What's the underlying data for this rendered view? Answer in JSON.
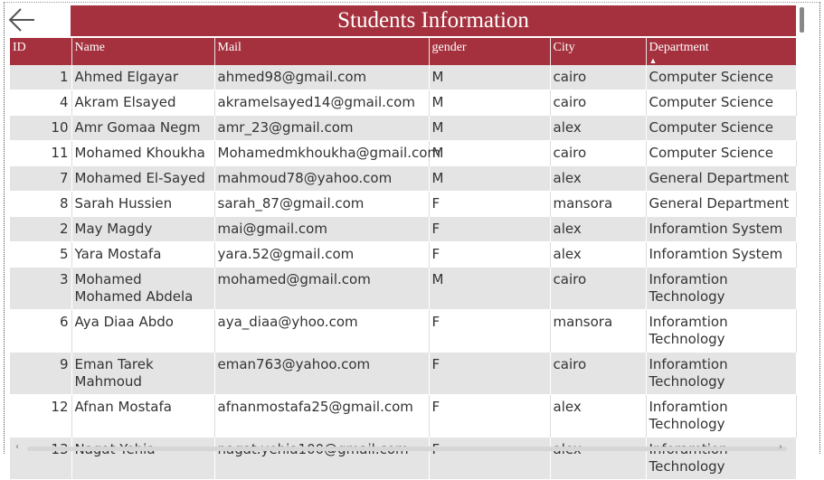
{
  "title": "Students Information",
  "icons": {
    "back": "arrow-left-icon"
  },
  "columns": [
    "ID",
    "Name",
    "Mail",
    "gender",
    "City",
    "Department"
  ],
  "sorted_column": "Department",
  "sort_indicator": "▲",
  "rows": [
    {
      "id": "1",
      "name": "Ahmed Elgayar",
      "mail": "ahmed98@gmail.com",
      "gender": "M",
      "city": "cairo",
      "department": "Computer Science"
    },
    {
      "id": "4",
      "name": "Akram Elsayed",
      "mail": "akramelsayed14@gmail.com",
      "gender": "M",
      "city": "cairo",
      "department": "Computer Science"
    },
    {
      "id": "10",
      "name": "Amr Gomaa Negm",
      "mail": "amr_23@gmail.com",
      "gender": "M",
      "city": "alex",
      "department": "Computer Science"
    },
    {
      "id": "11",
      "name": "Mohamed Khoukha",
      "mail": "Mohamedmkhoukha@gmail.com",
      "gender": "M",
      "city": "cairo",
      "department": "Computer Science"
    },
    {
      "id": "7",
      "name": "Mohamed El-Sayed",
      "mail": "mahmoud78@yahoo.com",
      "gender": "M",
      "city": "alex",
      "department": "General Department"
    },
    {
      "id": "8",
      "name": "Sarah Hussien",
      "mail": "sarah_87@gmail.com",
      "gender": "F",
      "city": "mansora",
      "department": "General Department"
    },
    {
      "id": "2",
      "name": "May Magdy",
      "mail": "mai@gmail.com",
      "gender": "F",
      "city": "alex",
      "department": "Inforamtion System"
    },
    {
      "id": "5",
      "name": "Yara Mostafa",
      "mail": "yara.52@gmail.com",
      "gender": "F",
      "city": "alex",
      "department": "Inforamtion System"
    },
    {
      "id": "3",
      "name": "Mohamed Mohamed Abdela",
      "mail": "mohamed@gmail.com",
      "gender": "M",
      "city": "cairo",
      "department": "Inforamtion Technology"
    },
    {
      "id": "6",
      "name": "Aya Diaa Abdo",
      "mail": "aya_diaa@yhoo.com",
      "gender": "F",
      "city": "mansora",
      "department": "Inforamtion Technology"
    },
    {
      "id": "9",
      "name": "Eman Tarek Mahmoud",
      "mail": "eman763@yahoo.com",
      "gender": "F",
      "city": "cairo",
      "department": "Inforamtion Technology"
    },
    {
      "id": "12",
      "name": "Afnan Mostafa",
      "mail": "afnanmostafa25@gmail.com",
      "gender": "F",
      "city": "alex",
      "department": "Inforamtion Technology"
    },
    {
      "id": "13",
      "name": "Nagat Yehia",
      "mail": "nagat.yehia100@gmail.com",
      "gender": "F",
      "city": "alex",
      "department": "Inforamtion Technology"
    }
  ],
  "scroll": {
    "left_arrow": "‹",
    "right_arrow": "›"
  },
  "colors": {
    "header_bg": "#a4313d",
    "row_alt": "#e5e4e4"
  }
}
